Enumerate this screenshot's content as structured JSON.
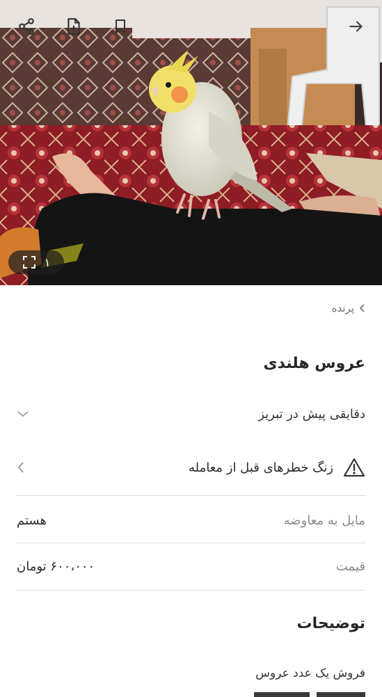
{
  "header": {
    "photo_counter": "۱",
    "icons": [
      "share-icon",
      "add-note-icon",
      "bookmark-icon",
      "arrow-right-icon",
      "fullscreen-icon"
    ]
  },
  "breadcrumb": {
    "label": "پرنده"
  },
  "listing": {
    "title": "عروس هلندی",
    "subtitle": "دقایقی پیش در تبریز",
    "warning": "زنگ خطرهای قبل از معامله"
  },
  "details": {
    "exchange_label": "مایل به معاوضه",
    "exchange_value": "هستم",
    "price_label": "قیمت",
    "price_value": "۶۰۰،۰۰۰ تومان"
  },
  "description": {
    "heading": "توضیحات",
    "text": "فروش یک عدد عروس"
  },
  "colors": {
    "text": "#2b2b2b",
    "muted": "#8a8a8a",
    "divider": "#d9d9d9",
    "background": "#ffffff"
  }
}
